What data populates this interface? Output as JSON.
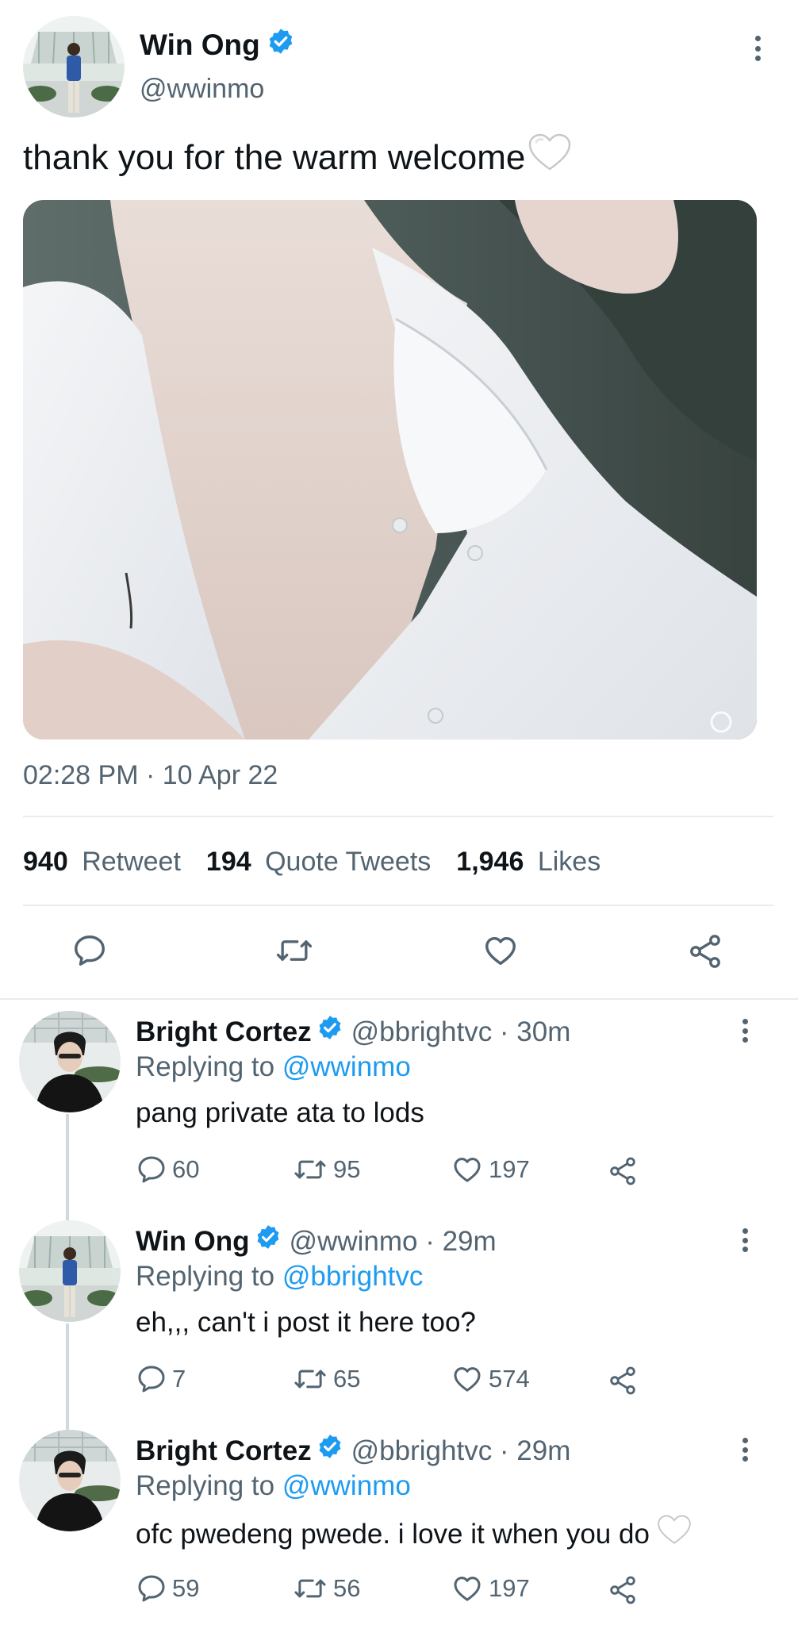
{
  "main_tweet": {
    "name": "Win Ong",
    "handle": "@wwinmo",
    "text": "thank you for the warm welcome",
    "timestamp": "02:28 PM · 10 Apr 22",
    "stats": {
      "retweet_count": "940",
      "retweet_label": "Retweet",
      "quote_count": "194",
      "quote_label": "Quote Tweets",
      "like_count": "1,946",
      "like_label": "Likes"
    }
  },
  "replies": [
    {
      "name": "Bright Cortez",
      "handle_time": "@bbrightvc · 30m",
      "replying_prefix": "Replying to",
      "replying_to": "@wwinmo",
      "text": "pang private ata to lods",
      "replies": "60",
      "retweets": "95",
      "likes": "197"
    },
    {
      "name": "Win Ong",
      "handle_time": "@wwinmo · 29m",
      "replying_prefix": "Replying to",
      "replying_to": "@bbrightvc",
      "text": "eh,,, can't i post it here too?",
      "replies": "7",
      "retweets": "65",
      "likes": "574"
    },
    {
      "name": "Bright Cortez",
      "handle_time": "@bbrightvc · 29m",
      "replying_prefix": "Replying to",
      "replying_to": "@wwinmo",
      "text": "ofc pwedeng pwede. i love it when you do",
      "replies": "59",
      "retweets": "56",
      "likes": "197"
    }
  ],
  "colors": {
    "accent": "#1d9bf0",
    "secondary_text": "#536471",
    "divider": "#e8ecef"
  }
}
